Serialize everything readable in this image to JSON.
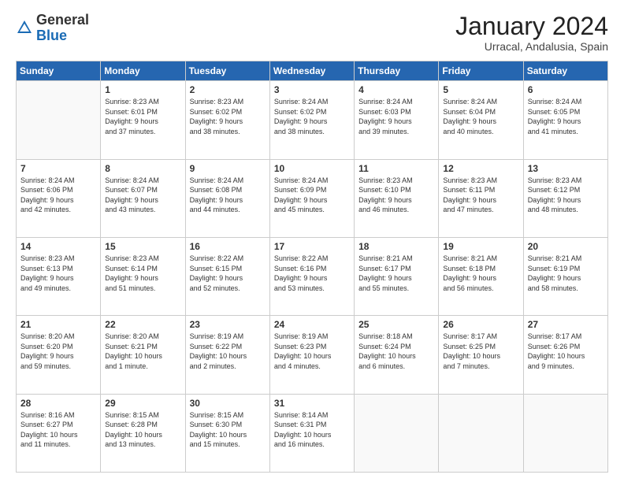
{
  "logo": {
    "general": "General",
    "blue": "Blue"
  },
  "title": "January 2024",
  "location": "Urracal, Andalusia, Spain",
  "days_header": [
    "Sunday",
    "Monday",
    "Tuesday",
    "Wednesday",
    "Thursday",
    "Friday",
    "Saturday"
  ],
  "weeks": [
    [
      {
        "num": "",
        "info": ""
      },
      {
        "num": "1",
        "info": "Sunrise: 8:23 AM\nSunset: 6:01 PM\nDaylight: 9 hours\nand 37 minutes."
      },
      {
        "num": "2",
        "info": "Sunrise: 8:23 AM\nSunset: 6:02 PM\nDaylight: 9 hours\nand 38 minutes."
      },
      {
        "num": "3",
        "info": "Sunrise: 8:24 AM\nSunset: 6:02 PM\nDaylight: 9 hours\nand 38 minutes."
      },
      {
        "num": "4",
        "info": "Sunrise: 8:24 AM\nSunset: 6:03 PM\nDaylight: 9 hours\nand 39 minutes."
      },
      {
        "num": "5",
        "info": "Sunrise: 8:24 AM\nSunset: 6:04 PM\nDaylight: 9 hours\nand 40 minutes."
      },
      {
        "num": "6",
        "info": "Sunrise: 8:24 AM\nSunset: 6:05 PM\nDaylight: 9 hours\nand 41 minutes."
      }
    ],
    [
      {
        "num": "7",
        "info": "Sunrise: 8:24 AM\nSunset: 6:06 PM\nDaylight: 9 hours\nand 42 minutes."
      },
      {
        "num": "8",
        "info": "Sunrise: 8:24 AM\nSunset: 6:07 PM\nDaylight: 9 hours\nand 43 minutes."
      },
      {
        "num": "9",
        "info": "Sunrise: 8:24 AM\nSunset: 6:08 PM\nDaylight: 9 hours\nand 44 minutes."
      },
      {
        "num": "10",
        "info": "Sunrise: 8:24 AM\nSunset: 6:09 PM\nDaylight: 9 hours\nand 45 minutes."
      },
      {
        "num": "11",
        "info": "Sunrise: 8:23 AM\nSunset: 6:10 PM\nDaylight: 9 hours\nand 46 minutes."
      },
      {
        "num": "12",
        "info": "Sunrise: 8:23 AM\nSunset: 6:11 PM\nDaylight: 9 hours\nand 47 minutes."
      },
      {
        "num": "13",
        "info": "Sunrise: 8:23 AM\nSunset: 6:12 PM\nDaylight: 9 hours\nand 48 minutes."
      }
    ],
    [
      {
        "num": "14",
        "info": "Sunrise: 8:23 AM\nSunset: 6:13 PM\nDaylight: 9 hours\nand 49 minutes."
      },
      {
        "num": "15",
        "info": "Sunrise: 8:23 AM\nSunset: 6:14 PM\nDaylight: 9 hours\nand 51 minutes."
      },
      {
        "num": "16",
        "info": "Sunrise: 8:22 AM\nSunset: 6:15 PM\nDaylight: 9 hours\nand 52 minutes."
      },
      {
        "num": "17",
        "info": "Sunrise: 8:22 AM\nSunset: 6:16 PM\nDaylight: 9 hours\nand 53 minutes."
      },
      {
        "num": "18",
        "info": "Sunrise: 8:21 AM\nSunset: 6:17 PM\nDaylight: 9 hours\nand 55 minutes."
      },
      {
        "num": "19",
        "info": "Sunrise: 8:21 AM\nSunset: 6:18 PM\nDaylight: 9 hours\nand 56 minutes."
      },
      {
        "num": "20",
        "info": "Sunrise: 8:21 AM\nSunset: 6:19 PM\nDaylight: 9 hours\nand 58 minutes."
      }
    ],
    [
      {
        "num": "21",
        "info": "Sunrise: 8:20 AM\nSunset: 6:20 PM\nDaylight: 9 hours\nand 59 minutes."
      },
      {
        "num": "22",
        "info": "Sunrise: 8:20 AM\nSunset: 6:21 PM\nDaylight: 10 hours\nand 1 minute."
      },
      {
        "num": "23",
        "info": "Sunrise: 8:19 AM\nSunset: 6:22 PM\nDaylight: 10 hours\nand 2 minutes."
      },
      {
        "num": "24",
        "info": "Sunrise: 8:19 AM\nSunset: 6:23 PM\nDaylight: 10 hours\nand 4 minutes."
      },
      {
        "num": "25",
        "info": "Sunrise: 8:18 AM\nSunset: 6:24 PM\nDaylight: 10 hours\nand 6 minutes."
      },
      {
        "num": "26",
        "info": "Sunrise: 8:17 AM\nSunset: 6:25 PM\nDaylight: 10 hours\nand 7 minutes."
      },
      {
        "num": "27",
        "info": "Sunrise: 8:17 AM\nSunset: 6:26 PM\nDaylight: 10 hours\nand 9 minutes."
      }
    ],
    [
      {
        "num": "28",
        "info": "Sunrise: 8:16 AM\nSunset: 6:27 PM\nDaylight: 10 hours\nand 11 minutes."
      },
      {
        "num": "29",
        "info": "Sunrise: 8:15 AM\nSunset: 6:28 PM\nDaylight: 10 hours\nand 13 minutes."
      },
      {
        "num": "30",
        "info": "Sunrise: 8:15 AM\nSunset: 6:30 PM\nDaylight: 10 hours\nand 15 minutes."
      },
      {
        "num": "31",
        "info": "Sunrise: 8:14 AM\nSunset: 6:31 PM\nDaylight: 10 hours\nand 16 minutes."
      },
      {
        "num": "",
        "info": ""
      },
      {
        "num": "",
        "info": ""
      },
      {
        "num": "",
        "info": ""
      }
    ]
  ]
}
